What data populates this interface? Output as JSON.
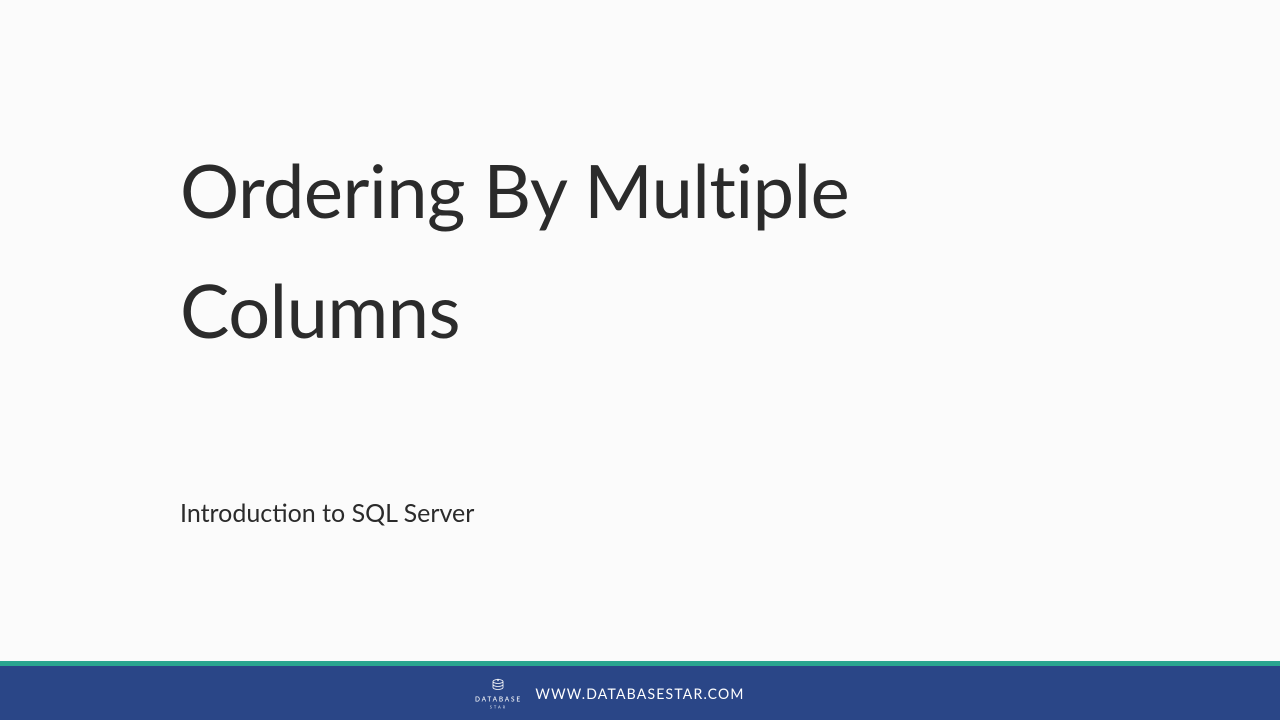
{
  "slide": {
    "title": "Ordering By Multiple Columns",
    "subtitle": "Introduction to SQL Server"
  },
  "footer": {
    "url": "WWW.DATABASESTAR.COM",
    "brand_name": "DATABASE",
    "brand_sub": "STAR"
  },
  "colors": {
    "accent": "#2aa590",
    "footer_bg": "#2a4687",
    "text": "#2b2b2b"
  }
}
